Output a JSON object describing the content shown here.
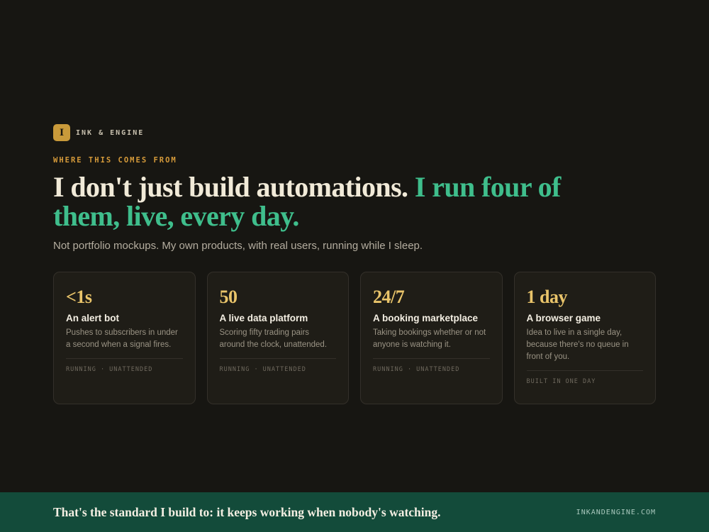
{
  "brand": {
    "badge_letter": "I",
    "name": "INK & ENGINE",
    "badge_color": "#c99a3a"
  },
  "hero": {
    "eyebrow": "WHERE THIS COMES FROM",
    "headline_main": "I don't just build automations. ",
    "headline_accent": "I run four of them, live, every day.",
    "subline": "Not portfolio mockups. My own products, with real users, running while I sleep.",
    "accent_color": "#3fbe8c",
    "eyebrow_color": "#d59a3a"
  },
  "cards": [
    {
      "stat": "<1s",
      "title": "An alert bot",
      "description": "Pushes to subscribers in under a second when a signal fires.",
      "status": "RUNNING · UNATTENDED"
    },
    {
      "stat": "50",
      "title": "A live data platform",
      "description": "Scoring fifty trading pairs around the clock, unattended.",
      "status": "RUNNING · UNATTENDED"
    },
    {
      "stat": "24/7",
      "title": "A booking marketplace",
      "description": "Taking bookings whether or not anyone is watching it.",
      "status": "RUNNING · UNATTENDED"
    },
    {
      "stat": "1 day",
      "title": "A browser game",
      "description": "Idea to live in a single day, because there's no queue in front of you.",
      "status": "BUILT IN ONE DAY"
    }
  ],
  "footer": {
    "tagline": "That's the standard I build to: it keeps working when nobody's watching.",
    "url": "INKANDENGINE.COM",
    "background_color": "#134b3a"
  }
}
